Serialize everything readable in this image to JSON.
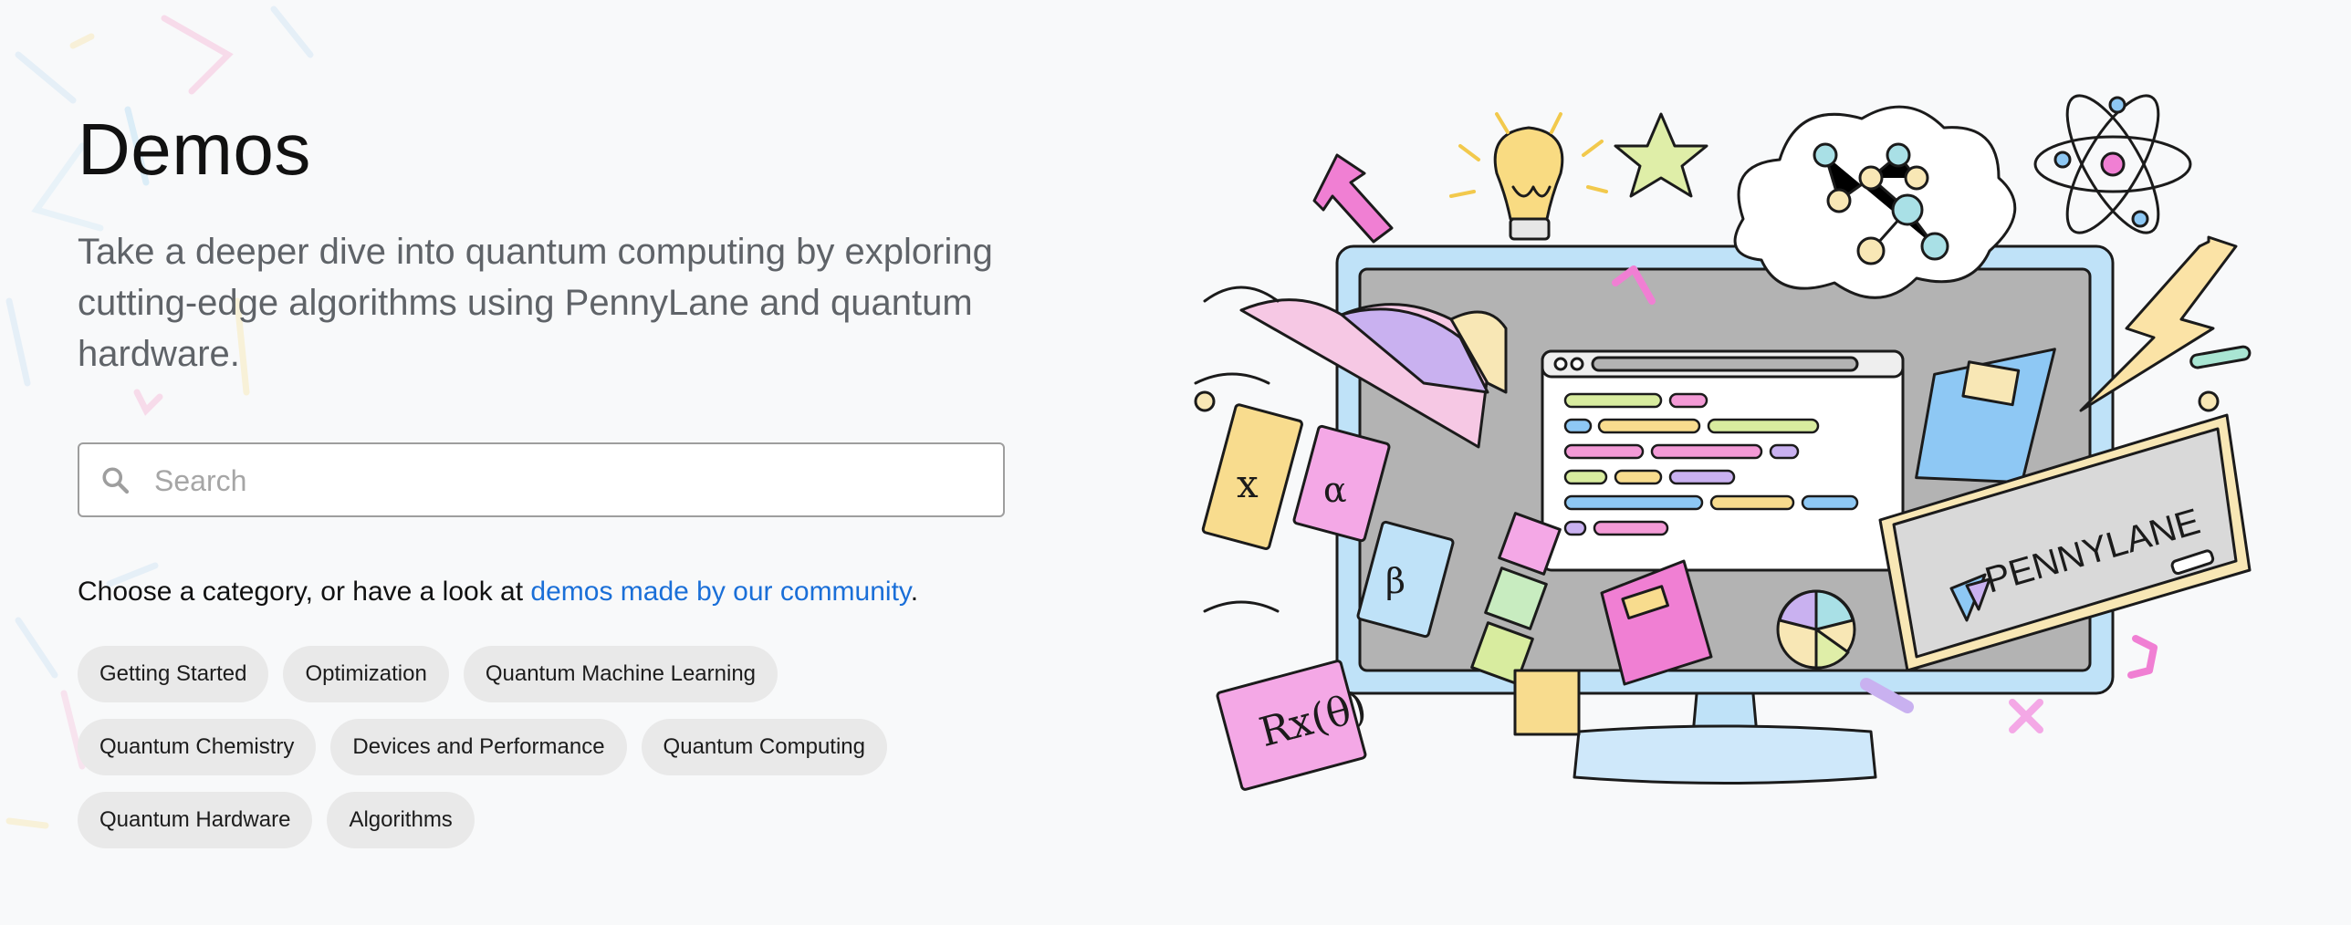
{
  "header": {
    "title": "Demos",
    "subtitle": "Take a deeper dive into quantum computing by exploring cutting-edge algorithms using PennyLane and quantum hardware."
  },
  "search": {
    "placeholder": "Search",
    "value": "",
    "icon": "search-icon"
  },
  "category_prompt": {
    "prefix": "Choose a category, or have a look at ",
    "link_text": "demos made by our community",
    "suffix": "."
  },
  "categories": {
    "row1": [
      "Getting Started",
      "Optimization",
      "Quantum Machine Learning"
    ],
    "row2": [
      "Quantum Chemistry",
      "Devices and Performance",
      "Quantum Computing"
    ],
    "row3": [
      "Quantum Hardware",
      "Algorithms"
    ]
  },
  "illustration": {
    "logo_text": "PENNYLANE",
    "gate_label": "Rx(θ)",
    "symbols": [
      "x",
      "α",
      "β"
    ]
  },
  "colors": {
    "link": "#1a6fd8",
    "chip_bg": "#e9e9e9",
    "text_muted": "#5f6368",
    "background": "#f8f9fa"
  }
}
